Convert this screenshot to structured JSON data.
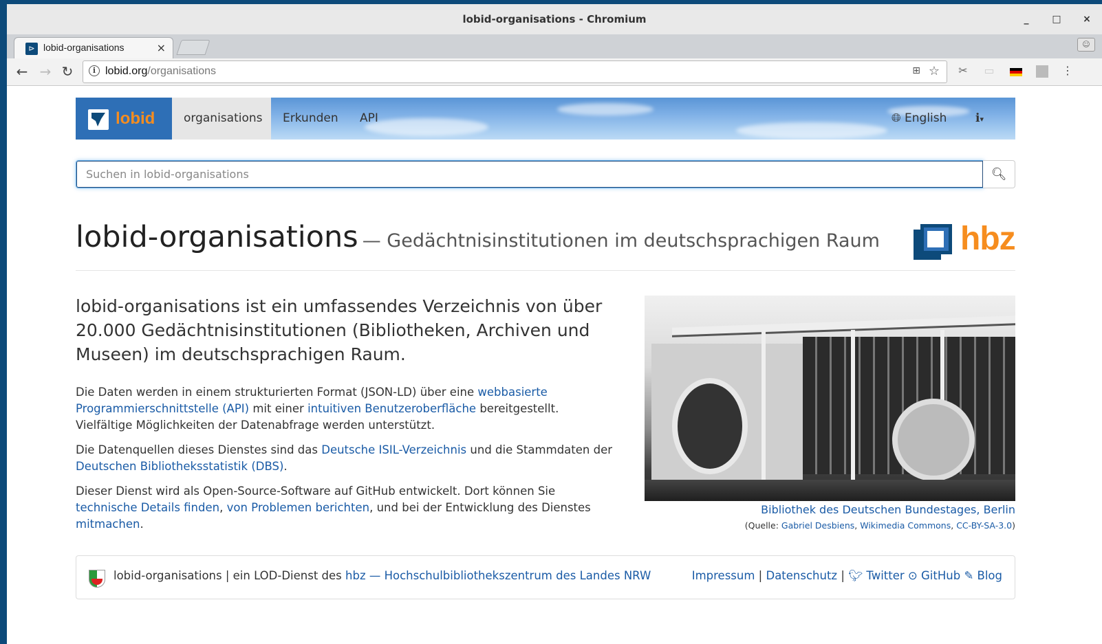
{
  "window": {
    "title": "lobid-organisations - Chromium",
    "controls": [
      "_",
      "□",
      "×"
    ]
  },
  "tab": {
    "title": "lobid-organisations",
    "close": "×"
  },
  "omnibox": {
    "domain": "lobid.org",
    "path": "/organisations"
  },
  "navbar": {
    "brand": "lobid",
    "items": [
      "organisations",
      "Erkunden",
      "API"
    ],
    "language": "English",
    "info_icon": "info-icon"
  },
  "search": {
    "placeholder": "Suchen in lobid-organisations"
  },
  "header": {
    "title": "lobid-organisations",
    "subtitle": "— Gedächtnisinstitutionen im deutschsprachigen Raum",
    "logo_text": "hbz"
  },
  "lead": "lobid-organisations ist ein umfassendes Verzeichnis von über 20.000 Gedächtnisinstitutionen (Bibliotheken, Archiven und Museen) im deutschsprachigen Raum.",
  "para1": {
    "t1": "Die Daten werden in einem strukturierten Format (JSON-LD) über eine ",
    "l1": "webbasierte Programmierschnittstelle (API)",
    "t2": " mit einer ",
    "l2": "intuitiven Benutzeroberfläche",
    "t3": " bereitgestellt. Vielfältige Möglichkeiten der Datenabfrage werden unterstützt."
  },
  "para2": {
    "t1": "Die Datenquellen dieses Dienstes sind das ",
    "l1": "Deutsche ISIL-Verzeichnis",
    "t2": " und die Stammdaten der ",
    "l2": "Deutschen Bibliotheksstatistik (DBS)",
    "t3": "."
  },
  "para3": {
    "t1": "Dieser Dienst wird als Open-Source-Software auf GitHub entwickelt. Dort können Sie ",
    "l1": "technische Details finden",
    "t2": ", ",
    "l2": "von Problemen berichten",
    "t3": ", und bei der Entwicklung des Dienstes ",
    "l3": "mitmachen",
    "t4": "."
  },
  "figure": {
    "caption": "Bibliothek des Deutschen Bundestages, Berlin",
    "credit_prefix": "(Quelle: ",
    "credit_author": "Gabriel Desbiens",
    "credit_sep": ", ",
    "credit_source": "Wikimedia Commons",
    "credit_license": "CC-BY-SA-3.0",
    "credit_suffix": ")"
  },
  "footer": {
    "left_text": "lobid-organisations | ein LOD-Dienst des ",
    "hbz_link": "hbz — Hochschulbibliothekszentrum des Landes NRW",
    "impressum": "Impressum",
    "sep": " | ",
    "datenschutz": "Datenschutz",
    "twitter": "Twitter",
    "github": "GitHub",
    "blog": "Blog"
  }
}
